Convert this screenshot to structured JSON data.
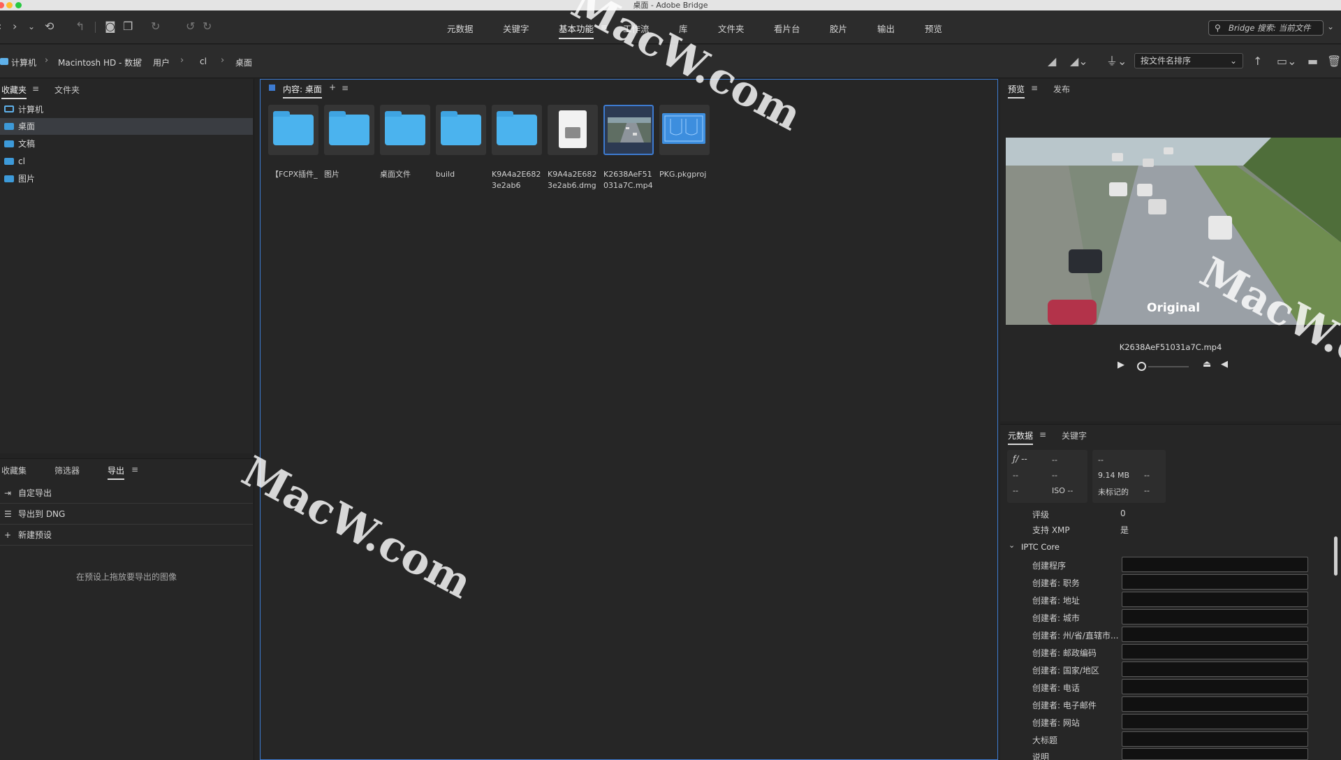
{
  "window": {
    "title": "桌面 - Adobe Bridge"
  },
  "toolbar": {
    "workspaces": [
      "元数据",
      "关键字",
      "基本功能",
      "工作流",
      "库",
      "文件夹",
      "看片台",
      "胶片",
      "输出",
      "预览"
    ],
    "active_workspace_menu": "≡",
    "search_placeholder": "Bridge 搜索: 当前文件"
  },
  "path": {
    "crumbs": [
      "计算机",
      "Macintosh HD - 数据",
      "用户",
      "cl",
      "桌面"
    ],
    "sort_label": "按文件名排序"
  },
  "left_top": {
    "tabs": [
      "收藏夹",
      "文件夹"
    ],
    "items": [
      "计算机",
      "桌面",
      "文稿",
      "cl",
      "图片"
    ]
  },
  "left_bottom": {
    "tabs": [
      "收藏集",
      "筛选器",
      "导出"
    ],
    "items": [
      "自定导出",
      "导出到 DNG",
      "新建预设"
    ],
    "hint": "在预设上拖放要导出的图像"
  },
  "content": {
    "header": "内容: 桌面",
    "items": [
      {
        "label": "【FCPX插件_",
        "kind": "folder"
      },
      {
        "label": "图片",
        "kind": "folder"
      },
      {
        "label": "桌面文件",
        "kind": "folder"
      },
      {
        "label": "build",
        "kind": "folder"
      },
      {
        "label": "K9A4a2E6823e2ab6",
        "kind": "folder"
      },
      {
        "label": "K9A4a2E6823e2ab6.dmg",
        "kind": "dmg"
      },
      {
        "label": "K2638AeF51031a7C.mp4",
        "kind": "video"
      },
      {
        "label": "PKG.pkgproj",
        "kind": "pkg"
      }
    ]
  },
  "preview": {
    "tabs": [
      "预览",
      "发布"
    ],
    "overlay_text": "Original",
    "filename": "K2638AeF51031a7C.mp4"
  },
  "metadata": {
    "tabs": [
      "元数据",
      "关键字"
    ],
    "camera": [
      "ƒ/ --",
      "--",
      "--",
      "--",
      "--",
      "ISO --"
    ],
    "file": [
      "--",
      "9.14 MB",
      "--",
      "未标记的",
      "--"
    ],
    "rows": [
      {
        "label": "评级",
        "value": "0"
      },
      {
        "label": "支持 XMP",
        "value": "是"
      }
    ],
    "section": "IPTC Core",
    "iptc_fields": [
      "创建程序",
      "创建者: 职务",
      "创建者: 地址",
      "创建者: 城市",
      "创建者: 州/省/直辖市...",
      "创建者: 邮政编码",
      "创建者: 国家/地区",
      "创建者: 电话",
      "创建者: 电子邮件",
      "创建者: 网站",
      "大标题",
      "说明"
    ]
  },
  "watermarks": [
    "MacW.com",
    "MacW.com",
    "MacW.c"
  ],
  "colors": {
    "accent": "#3d7bd1",
    "folder": "#4bb3ee",
    "background": "#232323"
  }
}
